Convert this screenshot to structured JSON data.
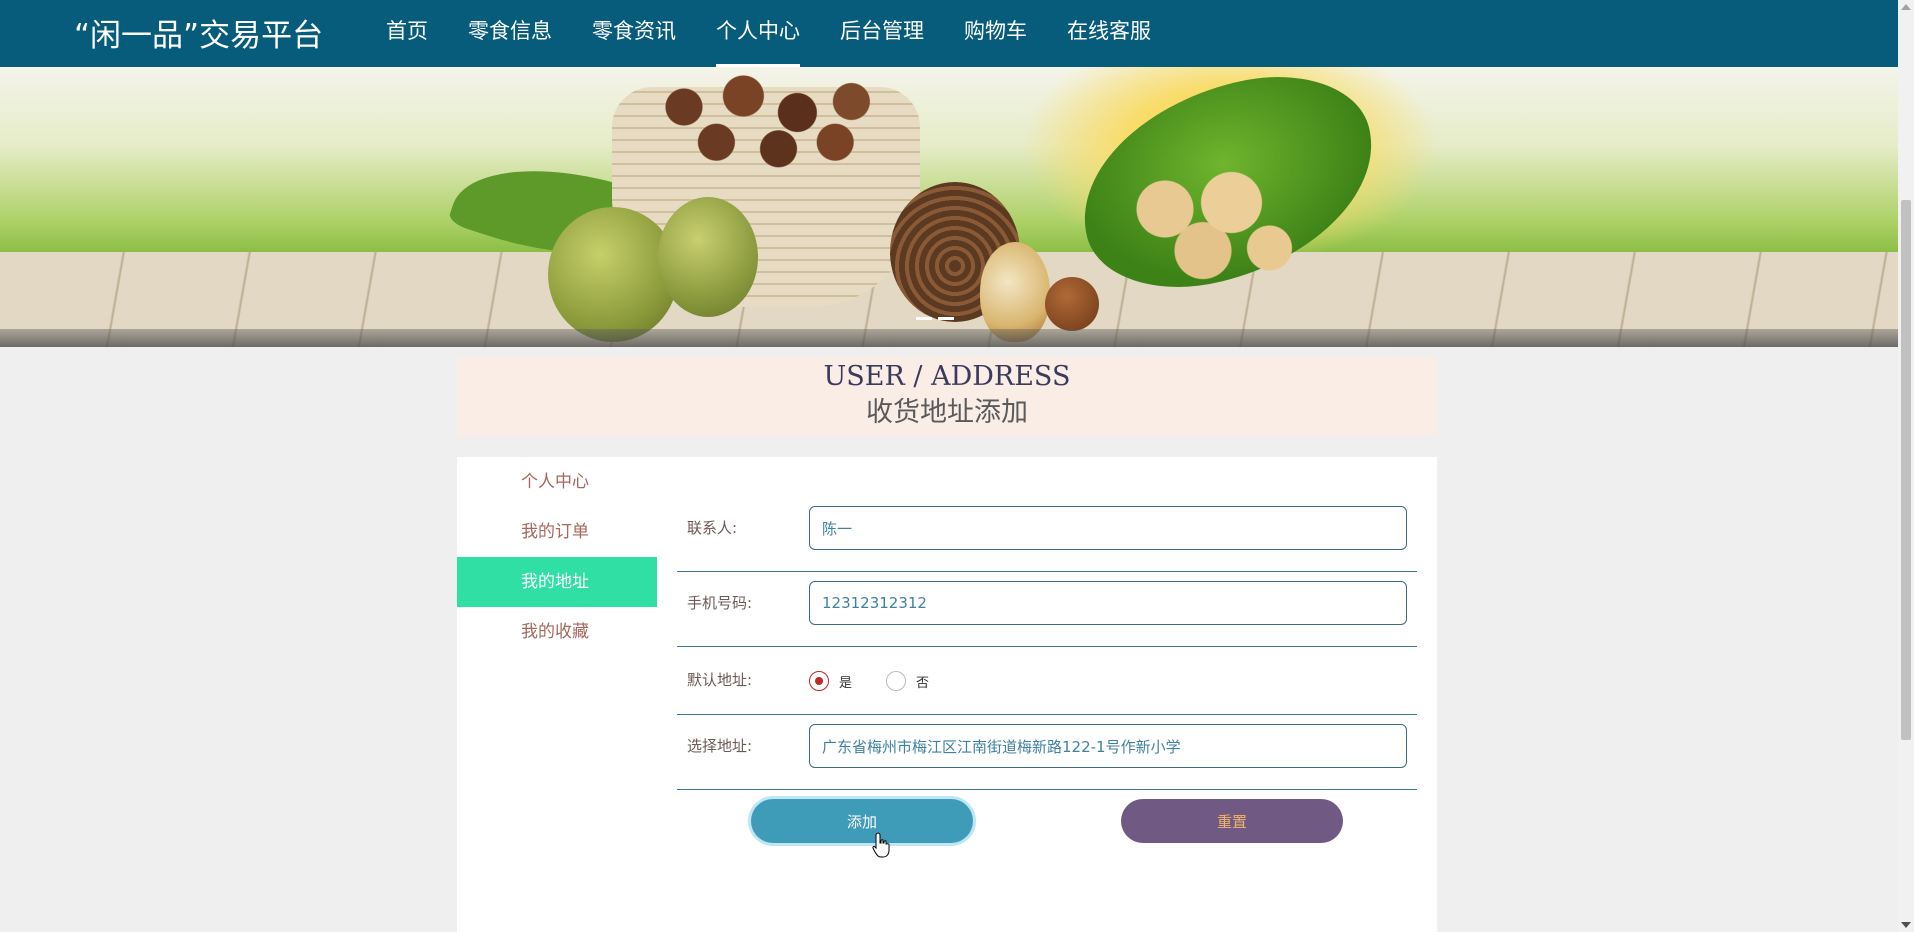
{
  "header": {
    "brand": "“闲一品”交易平台",
    "nav": [
      {
        "label": "首页"
      },
      {
        "label": "零食信息"
      },
      {
        "label": "零食资讯"
      },
      {
        "label": "个人中心",
        "active": true
      },
      {
        "label": "后台管理"
      },
      {
        "label": "购物车"
      },
      {
        "label": "在线客服"
      }
    ],
    "bg_color": "#075c7c"
  },
  "banner": {
    "carousel_dots": 2
  },
  "page_title": {
    "en": "USER / ADDRESS",
    "cn": "收货地址添加"
  },
  "sidebar": {
    "items": [
      {
        "label": "个人中心"
      },
      {
        "label": "我的订单"
      },
      {
        "label": "我的地址",
        "active": true
      },
      {
        "label": "我的收藏"
      }
    ],
    "active_color": "#2fdfa4"
  },
  "form": {
    "contact": {
      "label": "联系人:",
      "value": "陈一"
    },
    "phone": {
      "label": "手机号码:",
      "value": "12312312312"
    },
    "default": {
      "label": "默认地址:",
      "options": [
        "是",
        "否"
      ],
      "selected": "是"
    },
    "address": {
      "label": "选择地址:",
      "value": "广东省梅州市梅江区江南街道梅新路122-1号作新小学"
    },
    "add_button": "添加",
    "reset_button": "重置"
  }
}
